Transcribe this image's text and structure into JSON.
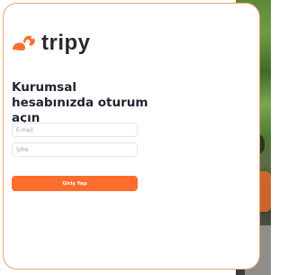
{
  "brand": {
    "name": "tripy",
    "accent_color": "#ff6d2d"
  },
  "login": {
    "title": "Kurumsal hesabınızda oturum açın",
    "email_placeholder": "E-mail",
    "password_placeholder": "Şifre",
    "submit_label": "Giriş Yap"
  }
}
